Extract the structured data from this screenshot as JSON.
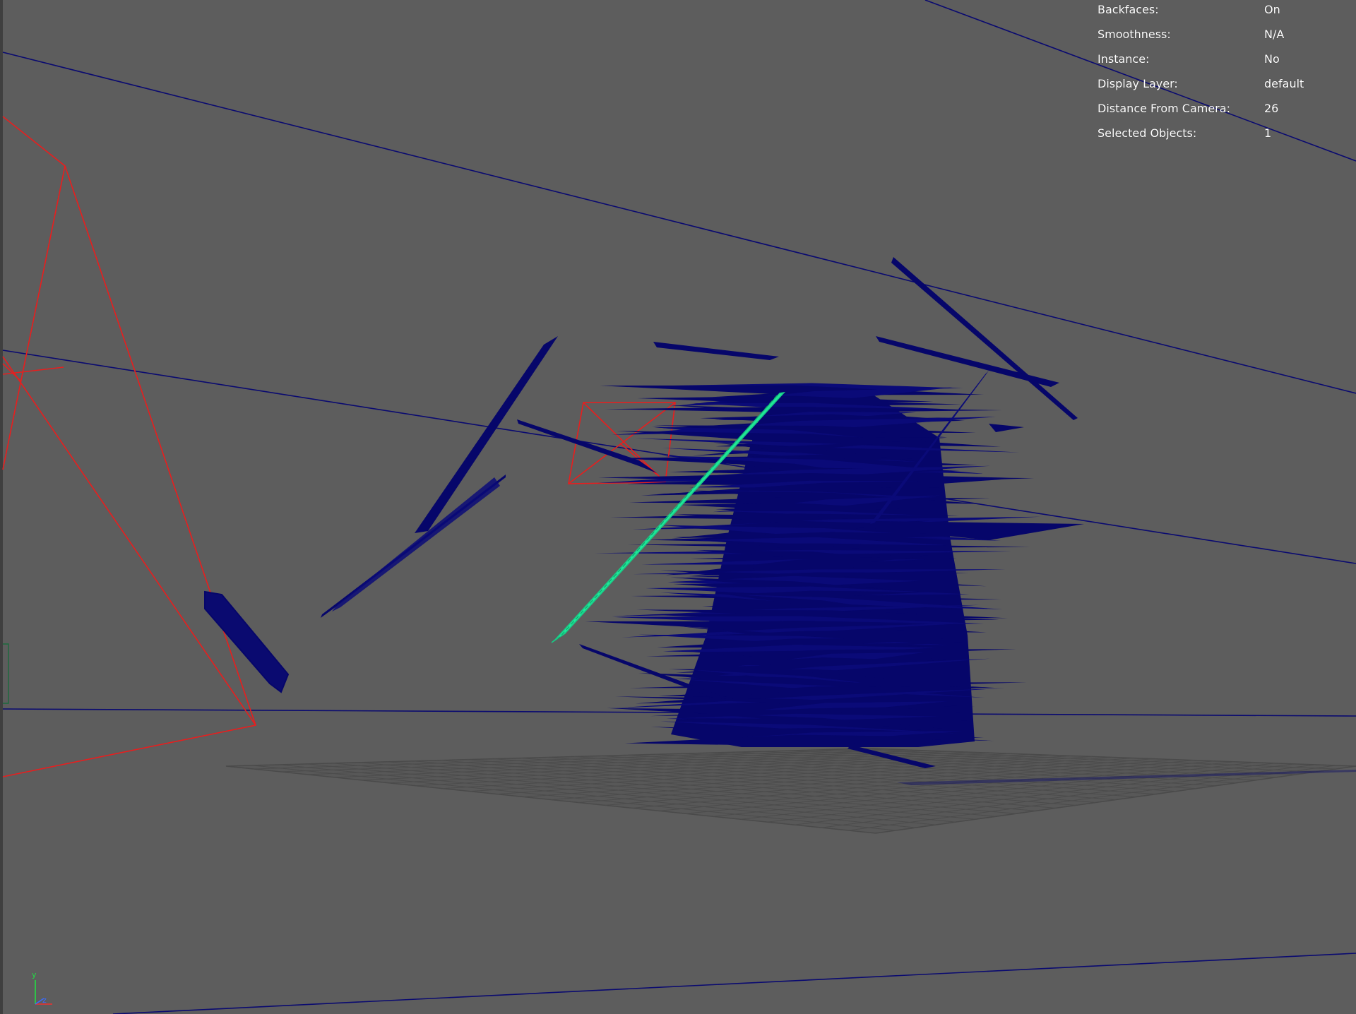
{
  "hud": {
    "rows": [
      {
        "label": "Backfaces:",
        "value": "On"
      },
      {
        "label": "Smoothness:",
        "value": "N/A"
      },
      {
        "label": "Instance:",
        "value": "No"
      },
      {
        "label": "Display Layer:",
        "value": "default"
      },
      {
        "label": "Distance From Camera:",
        "value": "26"
      },
      {
        "label": "Selected Objects:",
        "value": "1"
      }
    ]
  },
  "axis_gizmo": {
    "y_label": "y",
    "z_label": "z"
  },
  "colors": {
    "background": "#5d5d5d",
    "wireframe_blue": "#06066a",
    "selection_green": "#1fe89a",
    "camera_red": "#e81e1e",
    "grid": "#4a4a4a",
    "hud_text": "#ffffff"
  }
}
